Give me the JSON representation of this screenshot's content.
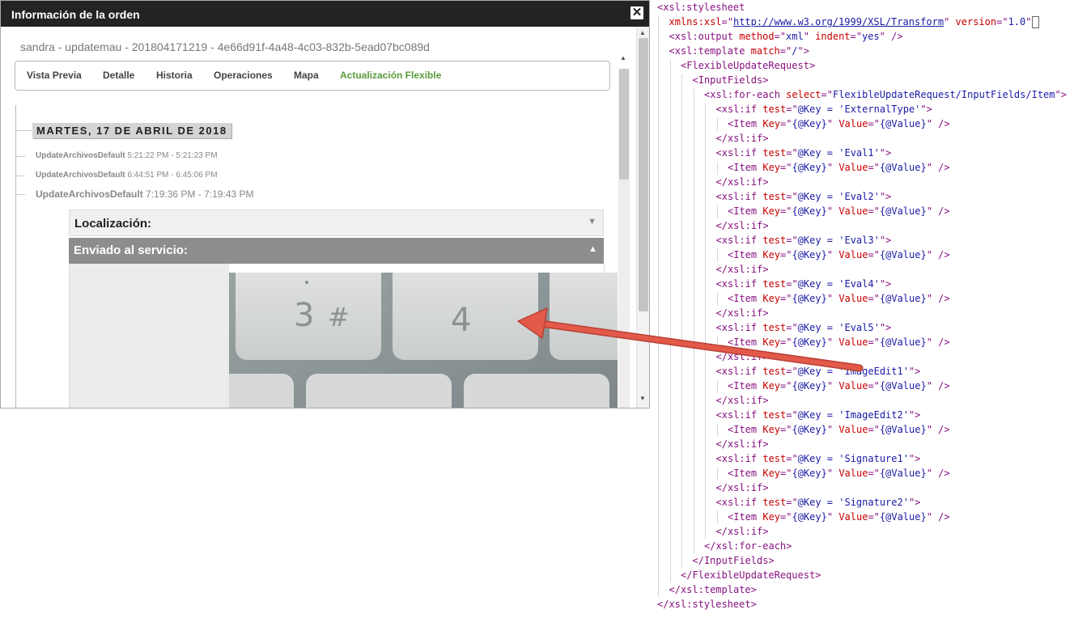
{
  "dialog": {
    "title": "Información de la orden",
    "close_symbol": "✕",
    "order_id": "sandra - updatemau - 201804171219 - 4e66d91f-4a48-4c03-832b-5ead07bc089d",
    "tabs": [
      {
        "label": "Vista Previa",
        "active": false
      },
      {
        "label": "Detalle",
        "active": false
      },
      {
        "label": "Historia",
        "active": false
      },
      {
        "label": "Operaciones",
        "active": false
      },
      {
        "label": "Mapa",
        "active": false
      },
      {
        "label": "Actualización Flexible",
        "active": true
      }
    ],
    "date_badge": "MARTES, 17 DE ABRIL DE 2018",
    "log_entries": [
      {
        "name": "UpdateArchivosDefault",
        "time": "5:21:22 PM - 5:21:23 PM"
      },
      {
        "name": "UpdateArchivosDefault",
        "time": "6:44:51 PM - 6:45:06 PM"
      },
      {
        "name": "UpdateArchivosDefault",
        "time": "7:19:36 PM - 7:19:43 PM"
      }
    ],
    "sections": {
      "localization": "Localización:",
      "sent_to_service": "Enviado al servicio:"
    },
    "photo_keys": [
      "3",
      "#",
      "4"
    ],
    "colors": {
      "active_tab": "#5a9c3c",
      "section_header": "#8d8d8d",
      "arrow": "#e35a4a"
    }
  },
  "code": {
    "lines": [
      {
        "indent": 0,
        "parts": [
          [
            "p",
            "<"
          ],
          [
            "t",
            "xsl:stylesheet"
          ]
        ]
      },
      {
        "indent": 1,
        "parts": [
          [
            "an",
            "xmlns:xsl"
          ],
          [
            "p",
            "=\""
          ],
          [
            "lnk",
            "http://www.w3.org/1999/XSL/Transform"
          ],
          [
            "p",
            "\" "
          ],
          [
            "an",
            "version"
          ],
          [
            "p",
            "=\""
          ],
          [
            "av",
            "1.0"
          ],
          [
            "p",
            "\""
          ],
          [
            "cursor",
            ""
          ]
        ]
      },
      {
        "indent": 1,
        "parts": [
          [
            "p",
            "<"
          ],
          [
            "t",
            "xsl:output "
          ],
          [
            "an",
            "method"
          ],
          [
            "p",
            "=\""
          ],
          [
            "av",
            "xml"
          ],
          [
            "p",
            "\" "
          ],
          [
            "an",
            "indent"
          ],
          [
            "p",
            "=\""
          ],
          [
            "av",
            "yes"
          ],
          [
            "p",
            "\" />"
          ]
        ]
      },
      {
        "indent": 1,
        "parts": [
          [
            "p",
            "<"
          ],
          [
            "t",
            "xsl:template "
          ],
          [
            "an",
            "match"
          ],
          [
            "p",
            "=\""
          ],
          [
            "av",
            "/"
          ],
          [
            "p",
            "\">"
          ]
        ]
      },
      {
        "indent": 2,
        "parts": [
          [
            "p",
            "<"
          ],
          [
            "t",
            "FlexibleUpdateRequest"
          ],
          [
            "p",
            ">"
          ]
        ]
      },
      {
        "indent": 3,
        "parts": [
          [
            "p",
            "<"
          ],
          [
            "t",
            "InputFields"
          ],
          [
            "p",
            ">"
          ]
        ]
      },
      {
        "indent": 4,
        "parts": [
          [
            "p",
            "<"
          ],
          [
            "t",
            "xsl:for-each "
          ],
          [
            "an",
            "select"
          ],
          [
            "p",
            "=\""
          ],
          [
            "av",
            "FlexibleUpdateRequest/InputFields/Item"
          ],
          [
            "p",
            "\">"
          ]
        ]
      },
      {
        "indent": 5,
        "parts": [
          [
            "p",
            "<"
          ],
          [
            "t",
            "xsl:if "
          ],
          [
            "an",
            "test"
          ],
          [
            "p",
            "=\""
          ],
          [
            "av",
            "@Key = 'ExternalType'"
          ],
          [
            "p",
            "\">"
          ]
        ]
      },
      {
        "indent": 6,
        "parts": [
          [
            "p",
            "<"
          ],
          [
            "t",
            "Item "
          ],
          [
            "an",
            "Key"
          ],
          [
            "p",
            "=\""
          ],
          [
            "av",
            "{@Key}"
          ],
          [
            "p",
            "\" "
          ],
          [
            "an",
            "Value"
          ],
          [
            "p",
            "=\""
          ],
          [
            "av",
            "{@Value}"
          ],
          [
            "p",
            "\" />"
          ]
        ]
      },
      {
        "indent": 5,
        "parts": [
          [
            "p",
            "</"
          ],
          [
            "t",
            "xsl:if"
          ],
          [
            "p",
            ">"
          ]
        ]
      },
      {
        "indent": 5,
        "parts": [
          [
            "p",
            "<"
          ],
          [
            "t",
            "xsl:if "
          ],
          [
            "an",
            "test"
          ],
          [
            "p",
            "=\""
          ],
          [
            "av",
            "@Key = 'Eval1'"
          ],
          [
            "p",
            "\">"
          ]
        ]
      },
      {
        "indent": 6,
        "parts": [
          [
            "p",
            "<"
          ],
          [
            "t",
            "Item "
          ],
          [
            "an",
            "Key"
          ],
          [
            "p",
            "=\""
          ],
          [
            "av",
            "{@Key}"
          ],
          [
            "p",
            "\" "
          ],
          [
            "an",
            "Value"
          ],
          [
            "p",
            "=\""
          ],
          [
            "av",
            "{@Value}"
          ],
          [
            "p",
            "\" />"
          ]
        ]
      },
      {
        "indent": 5,
        "parts": [
          [
            "p",
            "</"
          ],
          [
            "t",
            "xsl:if"
          ],
          [
            "p",
            ">"
          ]
        ]
      },
      {
        "indent": 5,
        "parts": [
          [
            "p",
            "<"
          ],
          [
            "t",
            "xsl:if "
          ],
          [
            "an",
            "test"
          ],
          [
            "p",
            "=\""
          ],
          [
            "av",
            "@Key = 'Eval2'"
          ],
          [
            "p",
            "\">"
          ]
        ]
      },
      {
        "indent": 6,
        "parts": [
          [
            "p",
            "<"
          ],
          [
            "t",
            "Item "
          ],
          [
            "an",
            "Key"
          ],
          [
            "p",
            "=\""
          ],
          [
            "av",
            "{@Key}"
          ],
          [
            "p",
            "\" "
          ],
          [
            "an",
            "Value"
          ],
          [
            "p",
            "=\""
          ],
          [
            "av",
            "{@Value}"
          ],
          [
            "p",
            "\" />"
          ]
        ]
      },
      {
        "indent": 5,
        "parts": [
          [
            "p",
            "</"
          ],
          [
            "t",
            "xsl:if"
          ],
          [
            "p",
            ">"
          ]
        ]
      },
      {
        "indent": 5,
        "parts": [
          [
            "p",
            "<"
          ],
          [
            "t",
            "xsl:if "
          ],
          [
            "an",
            "test"
          ],
          [
            "p",
            "=\""
          ],
          [
            "av",
            "@Key = 'Eval3'"
          ],
          [
            "p",
            "\">"
          ]
        ]
      },
      {
        "indent": 6,
        "parts": [
          [
            "p",
            "<"
          ],
          [
            "t",
            "Item "
          ],
          [
            "an",
            "Key"
          ],
          [
            "p",
            "=\""
          ],
          [
            "av",
            "{@Key}"
          ],
          [
            "p",
            "\" "
          ],
          [
            "an",
            "Value"
          ],
          [
            "p",
            "=\""
          ],
          [
            "av",
            "{@Value}"
          ],
          [
            "p",
            "\" />"
          ]
        ]
      },
      {
        "indent": 5,
        "parts": [
          [
            "p",
            "</"
          ],
          [
            "t",
            "xsl:if"
          ],
          [
            "p",
            ">"
          ]
        ]
      },
      {
        "indent": 5,
        "parts": [
          [
            "p",
            "<"
          ],
          [
            "t",
            "xsl:if "
          ],
          [
            "an",
            "test"
          ],
          [
            "p",
            "=\""
          ],
          [
            "av",
            "@Key = 'Eval4'"
          ],
          [
            "p",
            "\">"
          ]
        ]
      },
      {
        "indent": 6,
        "parts": [
          [
            "p",
            "<"
          ],
          [
            "t",
            "Item "
          ],
          [
            "an",
            "Key"
          ],
          [
            "p",
            "=\""
          ],
          [
            "av",
            "{@Key}"
          ],
          [
            "p",
            "\" "
          ],
          [
            "an",
            "Value"
          ],
          [
            "p",
            "=\""
          ],
          [
            "av",
            "{@Value}"
          ],
          [
            "p",
            "\" />"
          ]
        ]
      },
      {
        "indent": 5,
        "parts": [
          [
            "p",
            "</"
          ],
          [
            "t",
            "xsl:if"
          ],
          [
            "p",
            ">"
          ]
        ]
      },
      {
        "indent": 5,
        "parts": [
          [
            "p",
            "<"
          ],
          [
            "t",
            "xsl:if "
          ],
          [
            "an",
            "test"
          ],
          [
            "p",
            "=\""
          ],
          [
            "av",
            "@Key = 'Eval5'"
          ],
          [
            "p",
            "\">"
          ]
        ]
      },
      {
        "indent": 6,
        "parts": [
          [
            "p",
            "<"
          ],
          [
            "t",
            "Item "
          ],
          [
            "an",
            "Key"
          ],
          [
            "p",
            "=\""
          ],
          [
            "av",
            "{@Key}"
          ],
          [
            "p",
            "\" "
          ],
          [
            "an",
            "Value"
          ],
          [
            "p",
            "=\""
          ],
          [
            "av",
            "{@Value}"
          ],
          [
            "p",
            "\" />"
          ]
        ]
      },
      {
        "indent": 5,
        "parts": [
          [
            "p",
            "</"
          ],
          [
            "t",
            "xsl:if"
          ],
          [
            "p",
            ">"
          ]
        ]
      },
      {
        "indent": 5,
        "parts": [
          [
            "p",
            "<"
          ],
          [
            "t",
            "xsl:if "
          ],
          [
            "an",
            "test"
          ],
          [
            "p",
            "=\""
          ],
          [
            "av",
            "@Key = 'ImageEdit1'"
          ],
          [
            "p",
            "\">"
          ]
        ]
      },
      {
        "indent": 6,
        "parts": [
          [
            "p",
            "<"
          ],
          [
            "t",
            "Item "
          ],
          [
            "an",
            "Key"
          ],
          [
            "p",
            "=\""
          ],
          [
            "av",
            "{@Key}"
          ],
          [
            "p",
            "\" "
          ],
          [
            "an",
            "Value"
          ],
          [
            "p",
            "=\""
          ],
          [
            "av",
            "{@Value}"
          ],
          [
            "p",
            "\" />"
          ]
        ]
      },
      {
        "indent": 5,
        "parts": [
          [
            "p",
            "</"
          ],
          [
            "t",
            "xsl:if"
          ],
          [
            "p",
            ">"
          ]
        ]
      },
      {
        "indent": 5,
        "parts": [
          [
            "p",
            "<"
          ],
          [
            "t",
            "xsl:if "
          ],
          [
            "an",
            "test"
          ],
          [
            "p",
            "=\""
          ],
          [
            "av",
            "@Key = 'ImageEdit2'"
          ],
          [
            "p",
            "\">"
          ]
        ]
      },
      {
        "indent": 6,
        "parts": [
          [
            "p",
            "<"
          ],
          [
            "t",
            "Item "
          ],
          [
            "an",
            "Key"
          ],
          [
            "p",
            "=\""
          ],
          [
            "av",
            "{@Key}"
          ],
          [
            "p",
            "\" "
          ],
          [
            "an",
            "Value"
          ],
          [
            "p",
            "=\""
          ],
          [
            "av",
            "{@Value}"
          ],
          [
            "p",
            "\" />"
          ]
        ]
      },
      {
        "indent": 5,
        "parts": [
          [
            "p",
            "</"
          ],
          [
            "t",
            "xsl:if"
          ],
          [
            "p",
            ">"
          ]
        ]
      },
      {
        "indent": 5,
        "parts": [
          [
            "p",
            "<"
          ],
          [
            "t",
            "xsl:if "
          ],
          [
            "an",
            "test"
          ],
          [
            "p",
            "=\""
          ],
          [
            "av",
            "@Key = 'Signature1'"
          ],
          [
            "p",
            "\">"
          ]
        ]
      },
      {
        "indent": 6,
        "parts": [
          [
            "p",
            "<"
          ],
          [
            "t",
            "Item "
          ],
          [
            "an",
            "Key"
          ],
          [
            "p",
            "=\""
          ],
          [
            "av",
            "{@Key}"
          ],
          [
            "p",
            "\" "
          ],
          [
            "an",
            "Value"
          ],
          [
            "p",
            "=\""
          ],
          [
            "av",
            "{@Value}"
          ],
          [
            "p",
            "\" />"
          ]
        ]
      },
      {
        "indent": 5,
        "parts": [
          [
            "p",
            "</"
          ],
          [
            "t",
            "xsl:if"
          ],
          [
            "p",
            ">"
          ]
        ]
      },
      {
        "indent": 5,
        "parts": [
          [
            "p",
            "<"
          ],
          [
            "t",
            "xsl:if "
          ],
          [
            "an",
            "test"
          ],
          [
            "p",
            "=\""
          ],
          [
            "av",
            "@Key = 'Signature2'"
          ],
          [
            "p",
            "\">"
          ]
        ]
      },
      {
        "indent": 6,
        "parts": [
          [
            "p",
            "<"
          ],
          [
            "t",
            "Item "
          ],
          [
            "an",
            "Key"
          ],
          [
            "p",
            "=\""
          ],
          [
            "av",
            "{@Key}"
          ],
          [
            "p",
            "\" "
          ],
          [
            "an",
            "Value"
          ],
          [
            "p",
            "=\""
          ],
          [
            "av",
            "{@Value}"
          ],
          [
            "p",
            "\" />"
          ]
        ]
      },
      {
        "indent": 5,
        "parts": [
          [
            "p",
            "</"
          ],
          [
            "t",
            "xsl:if"
          ],
          [
            "p",
            ">"
          ]
        ]
      },
      {
        "indent": 4,
        "parts": [
          [
            "p",
            "</"
          ],
          [
            "t",
            "xsl:for-each"
          ],
          [
            "p",
            ">"
          ]
        ]
      },
      {
        "indent": 3,
        "parts": [
          [
            "p",
            "</"
          ],
          [
            "t",
            "InputFields"
          ],
          [
            "p",
            ">"
          ]
        ]
      },
      {
        "indent": 2,
        "parts": [
          [
            "p",
            "</"
          ],
          [
            "t",
            "FlexibleUpdateRequest"
          ],
          [
            "p",
            ">"
          ]
        ]
      },
      {
        "indent": 1,
        "parts": [
          [
            "p",
            "</"
          ],
          [
            "t",
            "xsl:template"
          ],
          [
            "p",
            ">"
          ]
        ]
      },
      {
        "indent": 0,
        "parts": [
          [
            "p",
            "</"
          ],
          [
            "t",
            "xsl:stylesheet"
          ],
          [
            "p",
            ">"
          ]
        ]
      }
    ],
    "colors": {
      "tag": "#881280",
      "attr_name": "#c80000",
      "attr_value": "#1a1aa6"
    }
  }
}
